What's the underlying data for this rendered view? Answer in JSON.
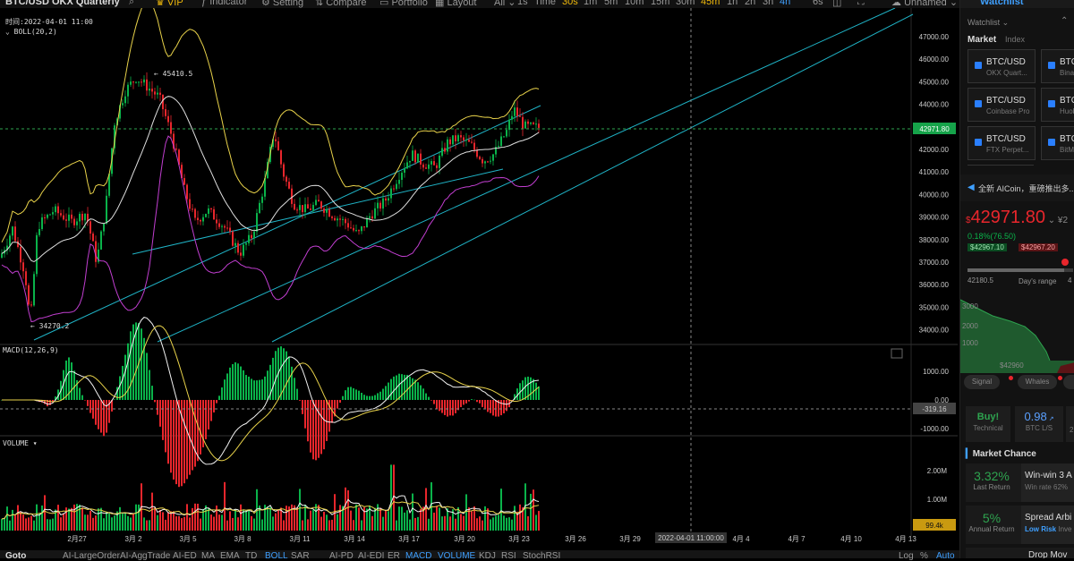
{
  "toolbar": {
    "symbol": "BTC/USD OKX Quarterly",
    "vip": "VIP",
    "indicator": "Indicator",
    "setting": "Setting",
    "compare": "Compare",
    "portfolio": "Portfolio",
    "layout": "Layout",
    "all": "All",
    "timeframes": [
      "1s",
      "Time",
      "30s",
      "1m",
      "5m",
      "10m",
      "15m",
      "30m",
      "45m",
      "1h",
      "2h",
      "3h",
      "4h"
    ],
    "bar_count": "6s",
    "unnamed": "Unnamed"
  },
  "legend": {
    "time": "时间:2022-04-01 11:00",
    "boll": "BOLL(20,2)",
    "macd": "MACD(12,26,9)",
    "volume": "VOLUME"
  },
  "price_annotations": {
    "high": "45410.5",
    "low": "34270.2"
  },
  "price_axis": [
    "47000.00",
    "46000.00",
    "45000.00",
    "44000.00",
    "43000.00",
    "42000.00",
    "41000.00",
    "40000.00",
    "39000.00",
    "38000.00",
    "37000.00",
    "36000.00",
    "35000.00",
    "34000.00"
  ],
  "current_price_tag": "42971.80",
  "macd_axis": [
    "1000.00",
    "0.00",
    "-1000.00"
  ],
  "macd_tag": "-319.16",
  "volume_axis": [
    "2.00M",
    "1.00M"
  ],
  "volume_tag": "99.4k",
  "date_axis": [
    "2月27",
    "3月 2",
    "3月 5",
    "3月 8",
    "3月 11",
    "3月 14",
    "3月 17",
    "3月 20",
    "3月 23",
    "3月 26",
    "3月 29",
    "4月 4",
    "4月 7",
    "4月 10",
    "4月 13"
  ],
  "crosshair_date": "2022-04-01 11:00:00",
  "bottom_tabs": [
    "Goto",
    "AI-LargeOrder",
    "AI-AggTrade",
    "AI-ED",
    "MA",
    "EMA",
    "TD",
    "BOLL",
    "SAR",
    "AI-PD",
    "AI-EDI",
    "ER",
    "MACD",
    "VOLUME",
    "KDJ",
    "RSI",
    "StochRSI"
  ],
  "bottom_right": [
    "Log",
    "%",
    "Auto"
  ],
  "panel": {
    "tab_watchlist": "Watchlist",
    "watchlist": "Watchlist",
    "market": "Market",
    "index": "Index",
    "cards": [
      {
        "pair": "BTC/USD",
        "exchange": "OKX Quart..."
      },
      {
        "pair": "BTC",
        "exchange": "Bina"
      },
      {
        "pair": "BTC/USD",
        "exchange": "Coinbase Pro"
      },
      {
        "pair": "BTC",
        "exchange": "Huob"
      },
      {
        "pair": "BTC/USD",
        "exchange": "FTX Perpet..."
      },
      {
        "pair": "BTC",
        "exchange": "BitM"
      }
    ],
    "notice": "全新 AICoin，重磅推出多...",
    "big_price": "42971.80",
    "currency_symbol": "$",
    "change": "0.18%(76.50)",
    "bid": "$42967.10",
    "ask": "$42967.20",
    "range_low": "42180.5",
    "range_label": "Day's range",
    "range_high": "4",
    "depth_labels": [
      "3000",
      "2000",
      "1000"
    ],
    "depth_price": "$42960",
    "signal_buttons": [
      "Signal",
      "Whales",
      "O"
    ],
    "buy_label": "Buy!",
    "buy_sub": "Technical",
    "ls_value": "0.98",
    "ls_label": "BTC L/S",
    "ls_extra": "2",
    "market_chance": "Market Chance",
    "chances": [
      {
        "value": "3.32%",
        "value_label": "Last Return",
        "title": "Win-win 3 A",
        "sub": "Win rate 62%"
      },
      {
        "value": "5%",
        "value_label": "Annual Return",
        "title": "Spread Arbi",
        "sub_hl": "Low Risk",
        "sub": "Inve"
      }
    ],
    "last_partial": "Drop Mov"
  },
  "colors": {
    "up": "#0ab34a",
    "down": "#e8262c",
    "accent": "#3fa0ff",
    "gold": "#f0b90b",
    "channel": "#1fb3c6",
    "boll_outer": "#e8d24a",
    "boll_mid": "#e0e0e0",
    "boll_lower": "#c13ed0",
    "price_tag": "#16a34a",
    "macd_tag": "#444",
    "volume_tag": "#c99a10"
  }
}
